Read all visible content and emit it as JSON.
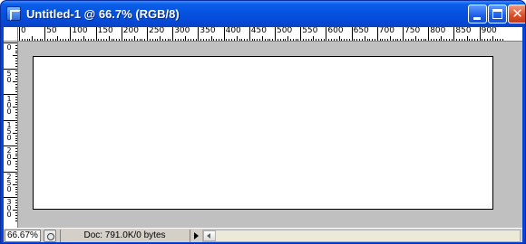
{
  "window": {
    "title": "Untitled-1 @ 66.7% (RGB/8)",
    "icons": {
      "app": "photoshop-document-icon",
      "minimize": "minimize-icon",
      "maximize": "maximize-icon",
      "close": "close-icon"
    },
    "close_glyph": "✕"
  },
  "rulers": {
    "horizontal_labels": [
      "0",
      "50",
      "100",
      "150",
      "200",
      "250",
      "300",
      "350",
      "400",
      "450",
      "500",
      "550",
      "600",
      "650",
      "700",
      "750",
      "800",
      "850",
      "900"
    ],
    "vertical_labels": [
      "0",
      "5\n0",
      "1\n0\n0",
      "1\n5\n0",
      "2\n0\n0",
      "2\n5\n0",
      "3\n0\n0"
    ],
    "unit": "pixels"
  },
  "canvas": {
    "zoom_percent": 66.7,
    "background_color": "#ffffff",
    "pasteboard_color": "#c0c0c0"
  },
  "statusbar": {
    "zoom": "66.67%",
    "nav_icon": "navigator-icon",
    "doc_info": "Doc: 791.0K/0 bytes",
    "menu_arrow_icon": "triangle-right-icon",
    "scroll_left_icon": "scroll-left-arrow-icon"
  }
}
